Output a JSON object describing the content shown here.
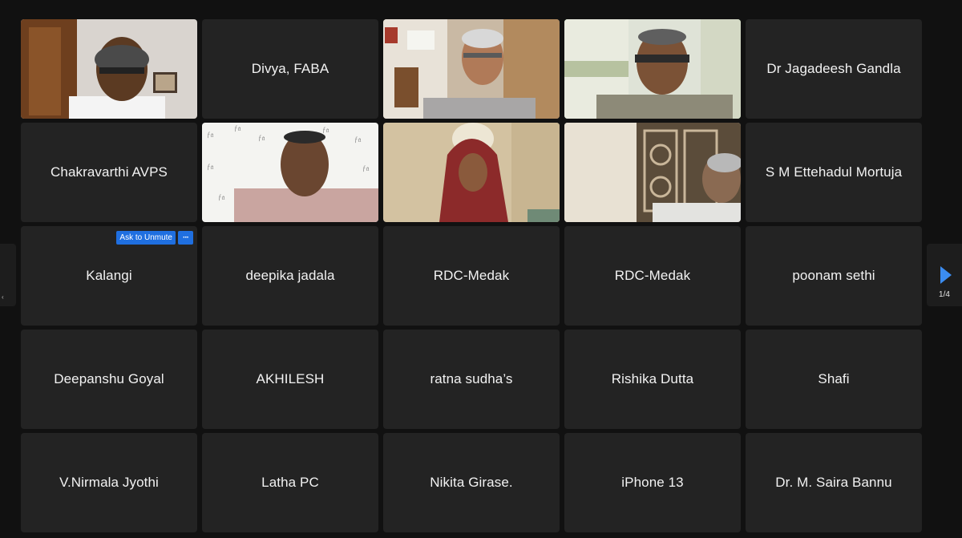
{
  "grid": {
    "tiles": [
      {
        "name": "",
        "video": "man-glasses-sofa",
        "active": false
      },
      {
        "name": "Divya, FABA",
        "active": false
      },
      {
        "name": "",
        "video": "man-bookshelf",
        "active": false
      },
      {
        "name": "",
        "video": "man-glasses-balcony",
        "active": true
      },
      {
        "name": "Dr Jagadeesh Gandla",
        "active": false
      },
      {
        "name": "Chakravarthi AVPS",
        "active": false
      },
      {
        "name": "",
        "video": "man-logo-backdrop",
        "active": false
      },
      {
        "name": "",
        "video": "woman-dupatta",
        "active": false
      },
      {
        "name": "",
        "video": "man-window-grill",
        "active": false
      },
      {
        "name": "S M Ettehadul Mortuja",
        "active": false
      },
      {
        "name": "Kalangi",
        "active": false,
        "ask_to_unmute": "Ask to Unmute",
        "more": "···"
      },
      {
        "name": "deepika jadala",
        "active": false
      },
      {
        "name": "RDC-Medak",
        "active": false
      },
      {
        "name": "RDC-Medak",
        "active": false
      },
      {
        "name": "poonam sethi",
        "active": false
      },
      {
        "name": "Deepanshu Goyal",
        "active": false
      },
      {
        "name": "AKHILESH",
        "active": false
      },
      {
        "name": "ratna sudha’s",
        "active": false
      },
      {
        "name": "Rishika Dutta",
        "active": false
      },
      {
        "name": "Shafi",
        "active": false
      },
      {
        "name": "V.Nirmala Jyothi",
        "active": false
      },
      {
        "name": "Latha PC",
        "active": false
      },
      {
        "name": "Nikita Girase.",
        "active": false
      },
      {
        "name": "iPhone 13",
        "active": false
      },
      {
        "name": "Dr. M. Saira Bannu",
        "active": false
      }
    ]
  },
  "navigation": {
    "prev_icon": "chevron-left-icon",
    "next_icon": "play-right-icon",
    "page_indicator": "1/4"
  },
  "colors": {
    "tile_bg": "#232323",
    "active_speaker": "#45c13d",
    "accent": "#1f6fe0"
  }
}
